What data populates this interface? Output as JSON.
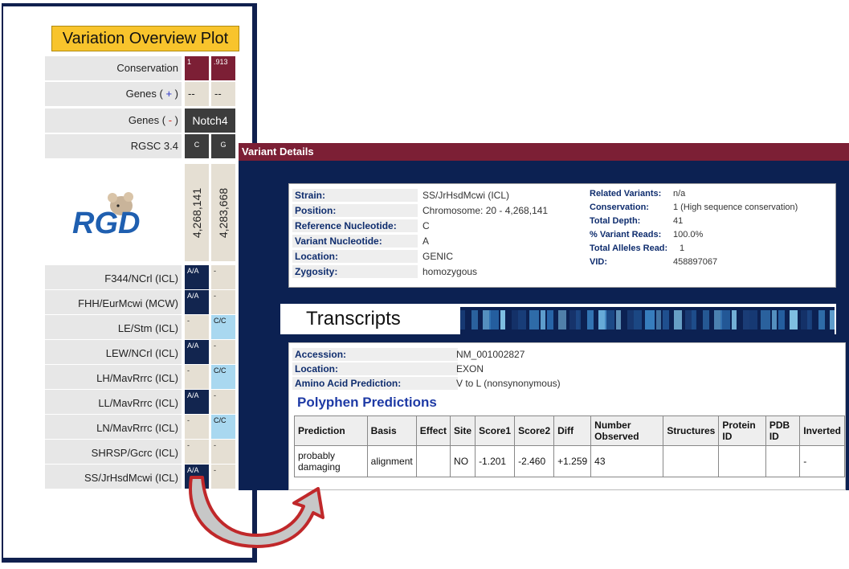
{
  "plot": {
    "title": "Variation Overview Plot",
    "track_labels": {
      "conservation": "Conservation",
      "genes_plus_prefix": "Genes (",
      "genes_plus_sign": " + ",
      "genes_minus_sign": " - ",
      "genes_suffix": ")",
      "rgsc": "RGSC 3.4"
    },
    "conservation_values": [
      "1",
      ".913"
    ],
    "genes_plus_values": [
      "--",
      "--"
    ],
    "genes_minus_value": "Notch4",
    "rgsc_values": [
      "C",
      "G"
    ],
    "positions": [
      "4,268,141",
      "4,283,668"
    ],
    "logo_text": "RGD",
    "strains": [
      {
        "name": "F344/NCrl (ICL)",
        "v1": "A/A",
        "v2": "-"
      },
      {
        "name": "FHH/EurMcwi (MCW)",
        "v1": "A/A",
        "v2": "-"
      },
      {
        "name": "LE/Stm (ICL)",
        "v1": "-",
        "v2": "C/C"
      },
      {
        "name": "LEW/NCrl (ICL)",
        "v1": "A/A",
        "v2": "-"
      },
      {
        "name": "LH/MavRrrc (ICL)",
        "v1": "-",
        "v2": "C/C"
      },
      {
        "name": "LL/MavRrrc (ICL)",
        "v1": "A/A",
        "v2": "-"
      },
      {
        "name": "LN/MavRrrc (ICL)",
        "v1": "-",
        "v2": "C/C"
      },
      {
        "name": "SHRSP/Gcrc (ICL)",
        "v1": "-",
        "v2": "-"
      },
      {
        "name": "SS/JrHsdMcwi (ICL)",
        "v1": "A/A",
        "v2": "-"
      }
    ]
  },
  "details": {
    "header": "Variant Details",
    "left": [
      {
        "k": "Strain:",
        "v": "SS/JrHsdMcwi (ICL)"
      },
      {
        "k": "Position:",
        "v": "Chromosome: 20 - 4,268,141"
      },
      {
        "k": "Reference Nucleotide:",
        "v": "C"
      },
      {
        "k": "Variant Nucleotide:",
        "v": "A"
      },
      {
        "k": "Location:",
        "v": "GENIC"
      },
      {
        "k": "Zygosity:",
        "v": "homozygous"
      }
    ],
    "right": [
      {
        "k": "Related Variants:",
        "v": "n/a"
      },
      {
        "k": "Conservation:",
        "v": "1 (High sequence conservation)"
      },
      {
        "k": "Total Depth:",
        "v": "41"
      },
      {
        "k": "% Variant Reads:",
        "v": "100.0%"
      },
      {
        "k": "Total Alleles Read:",
        "v": "1"
      },
      {
        "k": "VID:",
        "v": "458897067"
      }
    ]
  },
  "transcripts": {
    "title": "Transcripts",
    "rows": [
      {
        "k": "Accession:",
        "v": "NM_001002827"
      },
      {
        "k": "Location:",
        "v": "EXON"
      },
      {
        "k": "Amino Acid Prediction:",
        "v": "V to L (nonsynonymous)"
      }
    ],
    "polyphen_title": "Polyphen Predictions",
    "columns": [
      "Prediction",
      "Basis",
      "Effect",
      "Site",
      "Score1",
      "Score2",
      "Diff",
      "Number Observed",
      "Structures",
      "Protein ID",
      "PDB ID",
      "Inverted"
    ],
    "row": [
      "probably damaging",
      "alignment",
      "",
      "NO",
      "-1.201",
      "-2.460",
      "+1.259",
      "43",
      "",
      "",
      "",
      "-"
    ]
  },
  "colors": {
    "navy": "#12254f",
    "wine": "#7c1f35",
    "light_blue": "#a9d8f0",
    "title_yellow": "#f8c42c",
    "arrow_red": "#c0282a"
  }
}
